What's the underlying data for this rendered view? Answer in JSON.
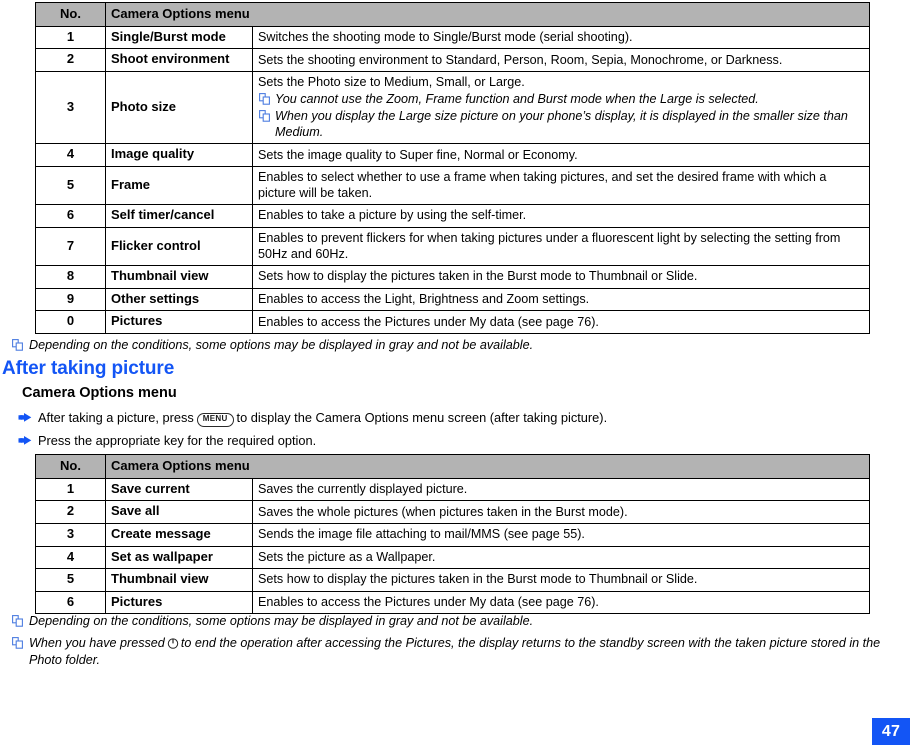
{
  "page_number": "47",
  "table_before": {
    "headers": {
      "no": "No.",
      "menu": "Camera Options menu"
    },
    "rows": [
      {
        "no": "1",
        "name": "Single/Burst mode",
        "desc": "Switches the shooting mode to Single/Burst mode (serial shooting).",
        "notes": []
      },
      {
        "no": "2",
        "name": "Shoot environment",
        "desc": "Sets the shooting environment to Standard, Person, Room, Sepia, Monochrome, or Darkness.",
        "notes": []
      },
      {
        "no": "3",
        "name": "Photo size",
        "desc": "Sets the Photo size to Medium, Small, or Large.",
        "notes": [
          "You cannot use the Zoom, Frame function and Burst mode when the Large is selected.",
          "When you display the Large size picture on your phone’s display, it is displayed in the smaller size than Medium."
        ]
      },
      {
        "no": "4",
        "name": "Image quality",
        "desc": "Sets the image quality to Super fine, Normal or Economy.",
        "notes": []
      },
      {
        "no": "5",
        "name": "Frame",
        "desc": "Enables to select whether to use a frame when taking pictures, and set the desired frame with which a picture will be taken.",
        "notes": []
      },
      {
        "no": "6",
        "name": "Self timer/cancel",
        "desc": "Enables to take a picture by using the self-timer.",
        "notes": []
      },
      {
        "no": "7",
        "name": "Flicker control",
        "desc": "Enables to prevent flickers for when taking pictures under a fluorescent light by selecting the setting from 50Hz and 60Hz.",
        "notes": []
      },
      {
        "no": "8",
        "name": "Thumbnail view",
        "desc": "Sets how to display the pictures taken in the Burst mode to Thumbnail or Slide.",
        "notes": []
      },
      {
        "no": "9",
        "name": "Other settings",
        "desc": "Enables to access the Light, Brightness and Zoom settings.",
        "notes": []
      },
      {
        "no": "0",
        "name": "Pictures",
        "desc": "Enables to access the Pictures under My data (see page 76).",
        "notes": []
      }
    ]
  },
  "note_after_table1": "Depending on the conditions, some options may be displayed in gray and not be available.",
  "heading": "After taking picture",
  "subheading": "Camera Options menu",
  "steps": [
    {
      "text_before": "After taking a picture, press",
      "key_label": "MENU",
      "text_after": "to display the Camera Options menu screen (after taking picture)."
    },
    {
      "text_before": "Press the appropriate key for the required option.",
      "key_label": "",
      "text_after": ""
    }
  ],
  "table_after": {
    "headers": {
      "no": "No.",
      "menu": "Camera Options menu"
    },
    "rows": [
      {
        "no": "1",
        "name": "Save current",
        "desc": "Saves the currently displayed picture."
      },
      {
        "no": "2",
        "name": "Save all",
        "desc": "Saves the whole pictures (when pictures taken in the Burst mode)."
      },
      {
        "no": "3",
        "name": "Create message",
        "desc": "Sends the image file attaching to mail/MMS (see page 55)."
      },
      {
        "no": "4",
        "name": "Set as wallpaper",
        "desc": "Sets the picture as a Wallpaper."
      },
      {
        "no": "5",
        "name": "Thumbnail view",
        "desc": "Sets how to display the pictures taken in the Burst mode to Thumbnail or Slide."
      },
      {
        "no": "6",
        "name": "Pictures",
        "desc": "Enables to access the Pictures under My data (see page 76)."
      }
    ]
  },
  "notes_after_table2": [
    {
      "text_before": "Depending on the conditions, some options may be displayed in gray and not be available.",
      "text_after": ""
    },
    {
      "text_before": "When you have pressed",
      "text_after": "to end the operation after accessing the Pictures, the display returns to the standby screen with the taken picture stored in the Photo folder."
    }
  ],
  "colors": {
    "heading_blue": "#1355f5",
    "table_header_gray": "#b3b3b3",
    "note_icon_blue": "#4d7de0",
    "badge_blue": "#1355f5"
  },
  "icons": {
    "note": "note-page-icon",
    "bullet": "pointing-hand-icon",
    "end_key": "end-key-icon"
  }
}
